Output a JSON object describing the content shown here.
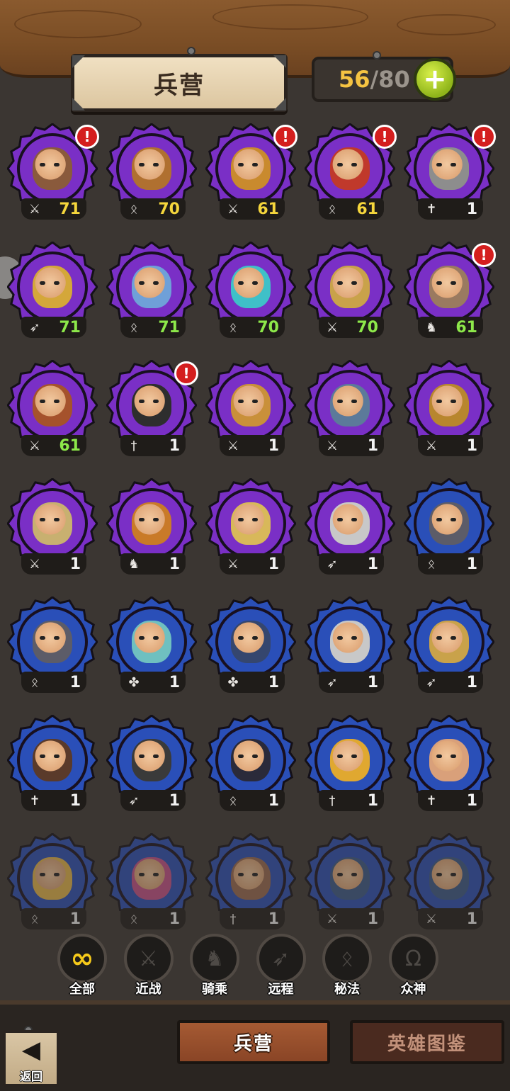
{
  "header": {
    "title": "兵营",
    "roster_current": "56",
    "roster_separator": "/",
    "roster_max": "80",
    "add_label": "+"
  },
  "heroes": [
    {
      "ring": "purple",
      "skin": "#8a5a3c",
      "level": "71",
      "level_color": "gold",
      "cls": "melee",
      "alert": true
    },
    {
      "ring": "purple",
      "skin": "#b07030",
      "level": "70",
      "level_color": "gold",
      "cls": "arcane",
      "alert": false
    },
    {
      "ring": "purple",
      "skin": "#c98a2e",
      "level": "61",
      "level_color": "gold",
      "cls": "melee",
      "alert": true
    },
    {
      "ring": "purple",
      "skin": "#c0392b",
      "level": "61",
      "level_color": "gold",
      "cls": "arcane",
      "alert": true
    },
    {
      "ring": "purple",
      "skin": "#8d8d8d",
      "level": "1",
      "level_color": "white",
      "cls": "holy",
      "alert": true
    },
    {
      "ring": "purple",
      "skin": "#d4a73a",
      "level": "71",
      "level_color": "green",
      "cls": "ranged",
      "alert": false
    },
    {
      "ring": "purple",
      "skin": "#6fa0d8",
      "level": "71",
      "level_color": "green",
      "cls": "arcane",
      "alert": false
    },
    {
      "ring": "purple",
      "skin": "#3fc0c8",
      "level": "70",
      "level_color": "green",
      "cls": "arcane",
      "alert": false
    },
    {
      "ring": "purple",
      "skin": "#c9a24a",
      "level": "70",
      "level_color": "green",
      "cls": "melee",
      "alert": false
    },
    {
      "ring": "purple",
      "skin": "#9a7a60",
      "level": "61",
      "level_color": "green",
      "cls": "mounted",
      "alert": true
    },
    {
      "ring": "purple",
      "skin": "#a5522c",
      "level": "61",
      "level_color": "green",
      "cls": "melee",
      "alert": false
    },
    {
      "ring": "purple",
      "skin": "#2e2e2e",
      "level": "1",
      "level_color": "white",
      "cls": "divine",
      "alert": true
    },
    {
      "ring": "purple",
      "skin": "#c9903a",
      "level": "1",
      "level_color": "white",
      "cls": "melee",
      "alert": false
    },
    {
      "ring": "purple",
      "skin": "#5c7a9a",
      "level": "1",
      "level_color": "white",
      "cls": "melee",
      "alert": false
    },
    {
      "ring": "purple",
      "skin": "#b8862e",
      "level": "1",
      "level_color": "white",
      "cls": "melee",
      "alert": false
    },
    {
      "ring": "purple",
      "skin": "#c8b070",
      "level": "1",
      "level_color": "white",
      "cls": "melee",
      "alert": false
    },
    {
      "ring": "purple",
      "skin": "#c97a28",
      "level": "1",
      "level_color": "white",
      "cls": "mounted",
      "alert": false
    },
    {
      "ring": "purple",
      "skin": "#d8b85a",
      "level": "1",
      "level_color": "white",
      "cls": "melee",
      "alert": false
    },
    {
      "ring": "purple",
      "skin": "#c8c8c8",
      "level": "1",
      "level_color": "white",
      "cls": "ranged",
      "alert": false
    },
    {
      "ring": "blue",
      "skin": "#5c5c68",
      "level": "1",
      "level_color": "white",
      "cls": "arcane",
      "alert": false
    },
    {
      "ring": "blue",
      "skin": "#5c5c68",
      "level": "1",
      "level_color": "white",
      "cls": "arcane",
      "alert": false
    },
    {
      "ring": "blue",
      "skin": "#6fc0c0",
      "level": "1",
      "level_color": "white",
      "cls": "mystic",
      "alert": false
    },
    {
      "ring": "blue",
      "skin": "#35466e",
      "level": "1",
      "level_color": "white",
      "cls": "mystic",
      "alert": false
    },
    {
      "ring": "blue",
      "skin": "#c8c8c8",
      "level": "1",
      "level_color": "white",
      "cls": "ranged",
      "alert": false
    },
    {
      "ring": "blue",
      "skin": "#c9a24a",
      "level": "1",
      "level_color": "white",
      "cls": "ranged",
      "alert": false
    },
    {
      "ring": "blue",
      "skin": "#5a3a2a",
      "level": "1",
      "level_color": "white",
      "cls": "holy",
      "alert": false
    },
    {
      "ring": "blue",
      "skin": "#3a3a3a",
      "level": "1",
      "level_color": "white",
      "cls": "ranged",
      "alert": false
    },
    {
      "ring": "blue",
      "skin": "#2a2a3a",
      "level": "1",
      "level_color": "white",
      "cls": "arcane",
      "alert": false
    },
    {
      "ring": "blue",
      "skin": "#e0a830",
      "level": "1",
      "level_color": "white",
      "cls": "divine",
      "alert": false
    },
    {
      "ring": "blue",
      "skin": "#d9a07a",
      "level": "1",
      "level_color": "white",
      "cls": "holy",
      "alert": false
    },
    {
      "ring": "blue",
      "skin": "#e6b84a",
      "level": "1",
      "level_color": "white",
      "cls": "arcane",
      "alert": false,
      "dim": true
    },
    {
      "ring": "blue",
      "skin": "#c8508a",
      "level": "1",
      "level_color": "white",
      "cls": "arcane",
      "alert": false,
      "dim": true
    },
    {
      "ring": "blue",
      "skin": "#9a6a50",
      "level": "1",
      "level_color": "white",
      "cls": "divine",
      "alert": false,
      "dim": true
    },
    {
      "ring": "blue",
      "skin": "#3a5a8a",
      "level": "1",
      "level_color": "white",
      "cls": "melee",
      "alert": false,
      "dim": true
    },
    {
      "ring": "blue",
      "skin": "#3a5a8a",
      "level": "1",
      "level_color": "white",
      "cls": "melee",
      "alert": false,
      "dim": true
    }
  ],
  "class_icons": {
    "melee": "sword-icon",
    "arcane": "arcane-rune-icon",
    "holy": "holy-cross-icon",
    "ranged": "bow-icon",
    "mounted": "horse-icon",
    "divine": "dagger-icon",
    "mystic": "paw-icon"
  },
  "filters": [
    {
      "id": "all",
      "label": "全部",
      "glyph": "∞",
      "icon": "infinity-icon"
    },
    {
      "id": "melee",
      "label": "近战",
      "glyph": "⚔",
      "icon": "sword-icon"
    },
    {
      "id": "mounted",
      "label": "骑乘",
      "glyph": "♞",
      "icon": "horse-icon"
    },
    {
      "id": "ranged",
      "label": "远程",
      "glyph": "➶",
      "icon": "bow-icon"
    },
    {
      "id": "arcane",
      "label": "秘法",
      "glyph": "ᛟ",
      "icon": "arcane-rune-icon"
    },
    {
      "id": "gods",
      "label": "众神",
      "glyph": "Ω",
      "icon": "omega-icon"
    }
  ],
  "bottom": {
    "back_label": "返回",
    "tab_barracks": "兵营",
    "tab_codex": "英雄图鉴"
  },
  "colors": {
    "purple_ring": "#7a2fc6",
    "blue_ring": "#2a4fb8",
    "alert_red": "#d41e1e",
    "gold_text": "#f5c342",
    "green_level": "#8de84a"
  }
}
